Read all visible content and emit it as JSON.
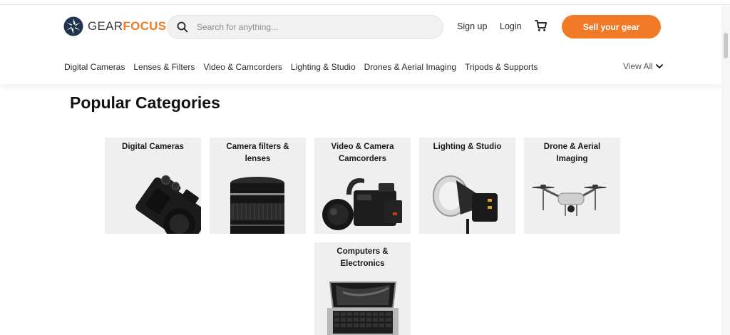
{
  "header": {
    "logo": {
      "word1": "GEAR",
      "word2": "FOCUS",
      "brand_color": "#f07a26"
    },
    "search": {
      "placeholder": "Search for anything..."
    },
    "signup_label": "Sign up",
    "login_label": "Login",
    "sell_label": "Sell your gear"
  },
  "category_nav": {
    "items": [
      {
        "label": "Digital Cameras"
      },
      {
        "label": "Lenses & Filters"
      },
      {
        "label": "Video & Camcorders"
      },
      {
        "label": "Lighting & Studio"
      },
      {
        "label": "Drones & Aerial Imaging"
      },
      {
        "label": "Tripods & Supports"
      }
    ],
    "view_all_label": "View All"
  },
  "main": {
    "section_title": "Popular Categories",
    "cards": [
      {
        "title": "Digital Cameras",
        "icon": "camera-image"
      },
      {
        "title": "Camera filters & lenses",
        "icon": "lens-image"
      },
      {
        "title": "Video & Camera Camcorders",
        "icon": "cinema-camera-image"
      },
      {
        "title": "Lighting & Studio",
        "icon": "studio-light-image"
      },
      {
        "title": "Drone & Aerial Imaging",
        "icon": "drone-image"
      },
      {
        "title": "Computers & Electronics",
        "icon": "laptop-image"
      }
    ]
  }
}
